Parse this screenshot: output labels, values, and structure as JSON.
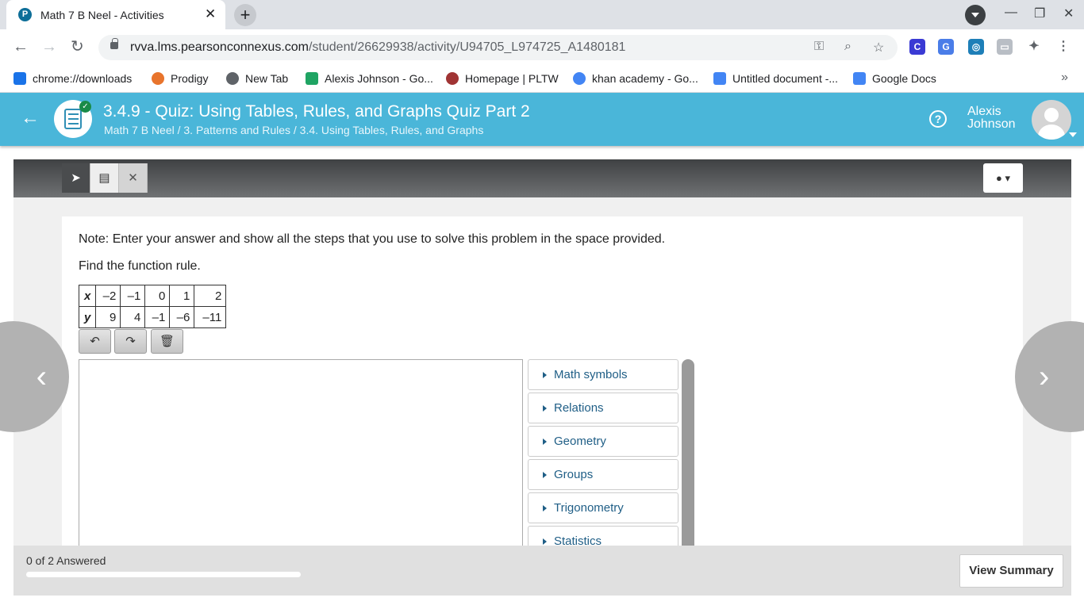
{
  "browser": {
    "tab_title": "Math 7 B Neel - Activities",
    "tab_favicon_letter": "P",
    "url_host": "rvva.lms.pearsonconnexus.com",
    "url_path": "/student/26629938/activity/U94705_L974725_A1480181",
    "bookmarks": [
      {
        "label": "chrome://downloads",
        "icon": "download-icon",
        "color": "#1a73e8"
      },
      {
        "label": "Prodigy",
        "icon": "prodigy-icon",
        "color": "#e8742c"
      },
      {
        "label": "New Tab",
        "icon": "globe-icon",
        "color": "#5f6368"
      },
      {
        "label": "Alexis Johnson - Go...",
        "icon": "google-drive-icon",
        "color": "#1fa463"
      },
      {
        "label": "Homepage | PLTW",
        "icon": "pltw-icon",
        "color": "#a03434"
      },
      {
        "label": "khan academy - Go...",
        "icon": "google-icon",
        "color": "#4285f4"
      },
      {
        "label": "Untitled document -...",
        "icon": "google-docs-icon",
        "color": "#4285f4"
      },
      {
        "label": "Google Docs",
        "icon": "google-docs-icon",
        "color": "#4285f4"
      }
    ]
  },
  "header": {
    "title": "3.4.9 - Quiz: Using Tables, Rules, and Graphs Quiz Part 2",
    "breadcrumb": "Math 7 B Neel / 3. Patterns and Rules / 3.4. Using Tables, Rules, and Graphs",
    "user_first": "Alexis",
    "user_last": "Johnson",
    "help_glyph": "?"
  },
  "question": {
    "note": "Note: Enter your answer and show all the steps that you use to solve this problem in the space provided.",
    "prompt": "Find the function rule.",
    "table": {
      "x_label": "x",
      "y_label": "y",
      "x": [
        "–2",
        "–1",
        "0",
        "1",
        "2"
      ],
      "y": [
        "9",
        "4",
        "–1",
        "–6",
        "–11"
      ]
    }
  },
  "palette": [
    "Math symbols",
    "Relations",
    "Geometry",
    "Groups",
    "Trigonometry",
    "Statistics"
  ],
  "footer": {
    "answered": "0 of 2 Answered",
    "progress": 0,
    "view_summary": "View Summary"
  },
  "colors": {
    "accent": "#4ab6d9",
    "link": "#1f5e86",
    "complete": "#1a8b47"
  }
}
